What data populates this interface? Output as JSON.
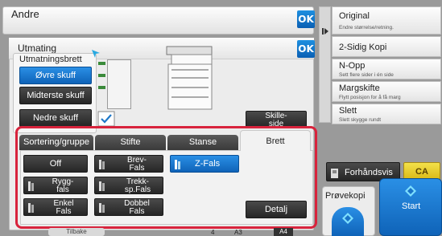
{
  "header": {
    "title": "Andre",
    "ok": "OK"
  },
  "dialog": {
    "title": "Utmating",
    "ok": "OK",
    "tray_label": "Utmatningsbrett",
    "tray_buttons": [
      "Øvre skuff",
      "Midterste skuff",
      "Nedre skuff"
    ],
    "skille_label": "Skille-\nside"
  },
  "tabs": [
    "Sortering/gruppe",
    "Stifte",
    "Stanse",
    "Brett"
  ],
  "fold": {
    "off": "Off",
    "brev": "Brev-\nFals",
    "zfals": "Z-Fals",
    "rygg": "Rygg-\nfals",
    "trekk": "Trekk-\nsp.Fals",
    "enkel": "Enkel\nFals",
    "dobbel": "Dobbel\nFals",
    "detalj": "Detalj"
  },
  "right": {
    "items": [
      {
        "title": "Original",
        "sub": "Endre størrelse/retning."
      },
      {
        "title": "2-Sidig Kopi",
        "sub": ""
      },
      {
        "title": "N-Opp",
        "sub": "Sett flere sider i én side"
      },
      {
        "title": "Margskifte",
        "sub": "Flytt posisjon for å få marg"
      },
      {
        "title": "Slett",
        "sub": "Slett skygge rundt"
      }
    ],
    "preview": "Forhåndsvis",
    "ca": "CA",
    "proof": "Prøvekopi",
    "start": "Start"
  },
  "footer": {
    "tilbake": "Tilbake",
    "num": "4",
    "paper1": "A3",
    "paper2": "A4"
  },
  "colors": {
    "accent_blue": "#0f63b8",
    "selection_red": "#d8233c",
    "dark_button": "#2f2f2f"
  }
}
